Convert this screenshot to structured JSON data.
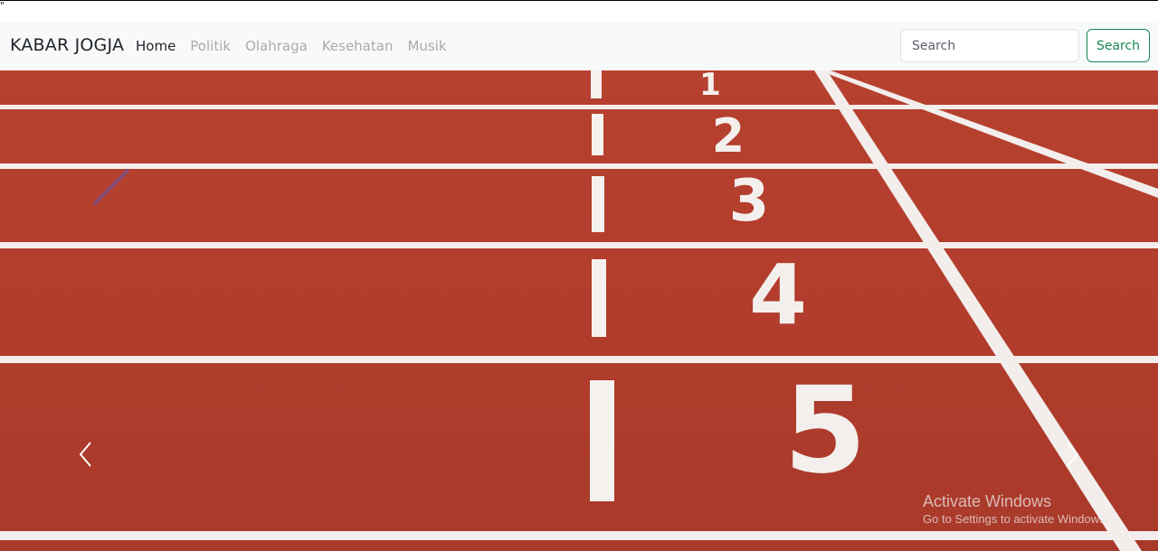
{
  "navbar": {
    "brand": "KABAR JOGJA",
    "links": [
      {
        "label": "Home",
        "active": true
      },
      {
        "label": "Politik",
        "active": false
      },
      {
        "label": "Olahraga",
        "active": false
      },
      {
        "label": "Kesehatan",
        "active": false
      },
      {
        "label": "Musik",
        "active": false
      }
    ],
    "search": {
      "placeholder": "Search",
      "button_label": "Search"
    }
  },
  "carousel": {
    "lane_numbers": [
      "1",
      "2",
      "3",
      "4",
      "5"
    ],
    "prev_icon": "chevron-left-icon",
    "next_icon": "chevron-right-icon"
  },
  "watermark": {
    "title": "Activate Windows",
    "subtitle": "Go to Settings to activate Windows."
  },
  "colors": {
    "navbar_bg": "#f8f9fa",
    "track_red": "#b53f2e",
    "track_line": "#f3eeec",
    "success": "#198754"
  }
}
